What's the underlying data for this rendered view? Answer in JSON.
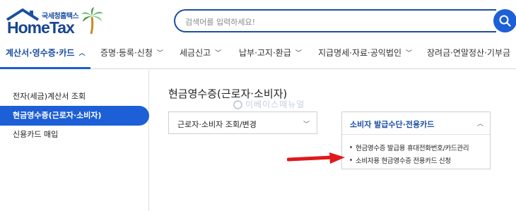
{
  "header": {
    "logo_small": "국세청홈택스",
    "logo_big": "HomeTax",
    "search_placeholder": "검색어를 입력하세요!",
    "brand_color": "#1d5fd6"
  },
  "nav": {
    "items": [
      {
        "label": "계산서·영수증·카드",
        "active": true
      },
      {
        "label": "증명·등록·신청"
      },
      {
        "label": "세금신고"
      },
      {
        "label": "납부·고지·환급"
      },
      {
        "label": "지급명세·자료·공익법인"
      },
      {
        "label": "장려금·연말정산·기부금"
      }
    ]
  },
  "sidebar": {
    "items": [
      {
        "label": "전자(세금)계산서 조회"
      },
      {
        "label": "현금영수증(근로자·소비자)",
        "active": true
      },
      {
        "label": "신용카드 매입"
      }
    ]
  },
  "main": {
    "title": "현금영수증(근로자·소비자)",
    "select_label": "근로자·소비자 조회/변경",
    "panel": {
      "title": "소비자 발급수단·전용카드",
      "items": [
        "현금영수증 발급용 휴대전화번호/카드관리",
        "소비자용 현금영수증 전용카드 신청"
      ]
    }
  },
  "watermark": "이베이스매뉴얼",
  "icons": {
    "search": "search-icon",
    "chevron_down": "chevron-down-icon",
    "chevron_up": "chevron-up-icon",
    "arrow": "red-arrow-icon"
  }
}
